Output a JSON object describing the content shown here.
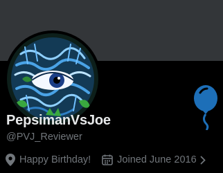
{
  "profile": {
    "display_name": "PepsimanVsJoe",
    "handle": "@PVJ_Reviewer",
    "birthday_text": "Happy Birthday!",
    "joined_text": "Joined June 2016"
  },
  "colors": {
    "background": "#000000",
    "banner": "#333639",
    "name_text": "#e7e9ea",
    "muted_text": "#71767b",
    "balloon": "#1d6fb8"
  },
  "icons": {
    "location": "map-pin-icon",
    "calendar": "calendar-icon",
    "more": "chevron-right-icon",
    "birthday": "balloon-icon"
  }
}
